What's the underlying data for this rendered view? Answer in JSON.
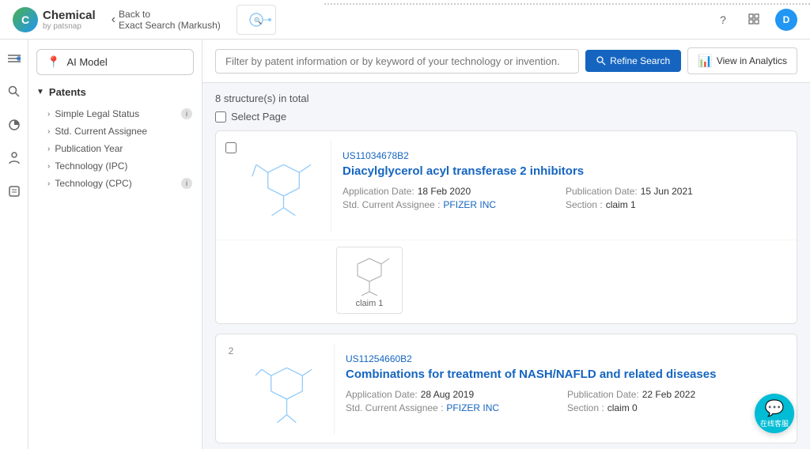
{
  "header": {
    "logo_icon": "C",
    "app_name": "Chemical",
    "app_sub": "by patsnap",
    "back_label": "Back to",
    "back_sublabel": "Exact Search (Markush)",
    "help_icon": "?",
    "grid_icon": "⊞",
    "avatar_label": "D"
  },
  "sidebar_icons": {
    "items": [
      "≡",
      "🔍",
      "◎",
      "👤",
      "📋"
    ]
  },
  "filter_panel": {
    "ai_model_label": "AI Model",
    "patents_label": "Patents",
    "items": [
      {
        "label": "Simple Legal Status",
        "has_info": true
      },
      {
        "label": "Std. Current Assignee",
        "has_info": false
      },
      {
        "label": "Publication Year",
        "has_info": false
      },
      {
        "label": "Technology (IPC)",
        "has_info": false
      },
      {
        "label": "Technology (CPC)",
        "has_info": true
      }
    ]
  },
  "topbar": {
    "search_placeholder": "Filter by patent information or by keyword of your technology or invention.",
    "refine_label": "Refine Search",
    "analytics_label": "View in Analytics"
  },
  "results": {
    "count_text": "8 structure(s) in total",
    "select_page_label": "Select Page",
    "cards": [
      {
        "number": "",
        "id": "US11034678B2",
        "title": "Diacylglycerol acyl transferase 2 inhibitors",
        "application_date_label": "Application Date:",
        "application_date_value": "18 Feb 2020",
        "publication_date_label": "Publication Date:",
        "publication_date_value": "15 Jun 2021",
        "assignee_label": "Std. Current Assignee :",
        "assignee_value": "PFIZER INC",
        "section_label": "Section :",
        "section_value": "claim 1",
        "expanded_image_label": "claim 1"
      },
      {
        "number": "2",
        "id": "US11254660B2",
        "title": "Combinations for treatment of NASH/NAFLD and related diseases",
        "application_date_label": "Application Date:",
        "application_date_value": "28 Aug 2019",
        "publication_date_label": "Publication Date:",
        "publication_date_value": "22 Feb 2022",
        "assignee_label": "Std. Current Assignee :",
        "assignee_value": "PFIZER INC",
        "section_label": "Section :",
        "section_value": "claim 0"
      }
    ]
  },
  "chat_widget": {
    "label": "在线客服"
  }
}
